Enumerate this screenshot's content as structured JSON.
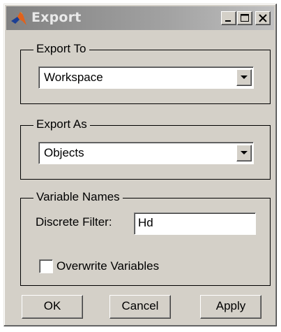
{
  "window": {
    "title": "Export",
    "icon": "matlab-logo-icon"
  },
  "title_buttons": {
    "minimize_icon": "minimize-icon",
    "maximize_icon": "maximize-icon",
    "close_icon": "close-icon"
  },
  "export_to": {
    "legend": "Export To",
    "selected": "Workspace"
  },
  "export_as": {
    "legend": "Export As",
    "selected": "Objects"
  },
  "variable_names": {
    "legend": "Variable Names",
    "discrete_filter_label": "Discrete Filter:",
    "discrete_filter_value": "Hd",
    "overwrite_label": "Overwrite Variables",
    "overwrite_checked": false
  },
  "buttons": {
    "ok": "OK",
    "cancel": "Cancel",
    "apply": "Apply"
  },
  "colors": {
    "face": "#d4d0c8",
    "titlebar_start": "#818181",
    "titlebar_end": "#c0c0c0",
    "title_text": "#e9e9e9",
    "logo_orange": "#e0621c",
    "logo_blue": "#1c3f94"
  }
}
